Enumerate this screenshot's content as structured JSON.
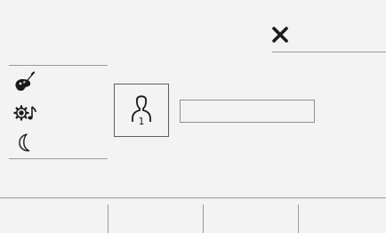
{
  "header": {
    "close_icon": "close-icon"
  },
  "sidebar": {
    "items": [
      {
        "name": "paint-palette-icon"
      },
      {
        "name": "settings-music-icon"
      },
      {
        "name": "moon-icon"
      }
    ]
  },
  "main": {
    "contact_icon": "user-1-icon",
    "contact_number": "1",
    "name_field_value": ""
  },
  "footer": {
    "segments": 4
  },
  "colors": {
    "background": "#f3f3f3",
    "lines": "#9a9a9a",
    "icons": "#1a1a1a"
  }
}
